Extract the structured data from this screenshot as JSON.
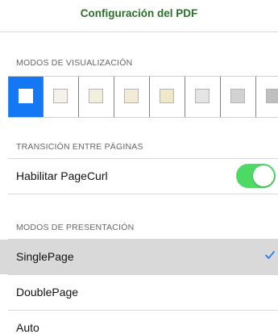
{
  "header": {
    "title": "Configuración del PDF",
    "title_color": "#2c6e2c"
  },
  "sections": {
    "visualization": {
      "header": "MODOS DE VISUALIZACIÓN",
      "modes": [
        {
          "color": "#ffffff",
          "selected": true
        },
        {
          "color": "#f4f2ea",
          "selected": false
        },
        {
          "color": "#f3efdd",
          "selected": false
        },
        {
          "color": "#f2ecd7",
          "selected": false
        },
        {
          "color": "#efe8c9",
          "selected": false
        },
        {
          "color": "#e5e5e5",
          "selected": false
        },
        {
          "color": "#d2d2d2",
          "selected": false
        },
        {
          "color": "#bfbfbf",
          "selected": false
        }
      ]
    },
    "transition": {
      "header": "TRANSICIÓN ENTRE PÁGINAS",
      "pagecurl_label": "Habilitar PageCurl",
      "pagecurl_enabled": true
    },
    "presentation": {
      "header": "MODOS DE PRESENTACIÓN",
      "options": [
        {
          "label": "SinglePage",
          "selected": true
        },
        {
          "label": "DoublePage",
          "selected": false
        },
        {
          "label": "Auto",
          "selected": false
        }
      ]
    }
  },
  "colors": {
    "accent": "#1478f5",
    "toggle_on": "#4cd964",
    "selected_row": "#d9d9d9"
  },
  "icons": {
    "selected_option": "checkmark-icon",
    "toggle": "toggle-switch"
  }
}
